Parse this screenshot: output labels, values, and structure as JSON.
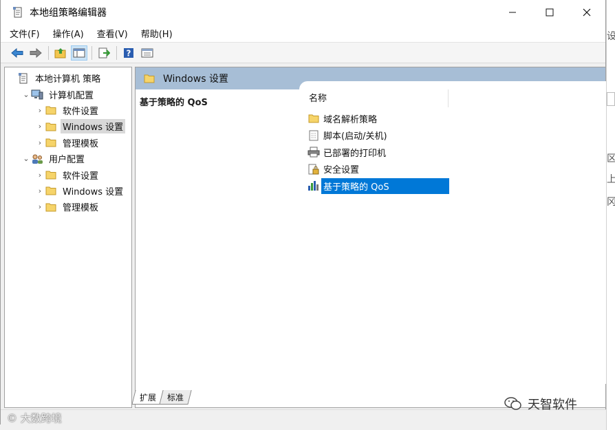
{
  "window": {
    "title": "本地组策略编辑器",
    "controls": {
      "minimize": "—",
      "maximize": "☐",
      "close": "✕"
    }
  },
  "menu": [
    "文件(F)",
    "操作(A)",
    "查看(V)",
    "帮助(H)"
  ],
  "toolbar": {
    "icons": [
      "back-arrow-icon",
      "forward-arrow-icon",
      "up-folder-icon",
      "show-hide-tree-icon",
      "export-list-icon",
      "help-icon",
      "properties-icon"
    ]
  },
  "tree": {
    "items": [
      {
        "label": "本地计算机 策略",
        "level": 0,
        "icon": "policy-icon",
        "chevron": ""
      },
      {
        "label": "计算机配置",
        "level": 1,
        "icon": "computer-icon",
        "chevron": "⌄"
      },
      {
        "label": "软件设置",
        "level": 2,
        "icon": "folder-icon",
        "chevron": "›"
      },
      {
        "label": "Windows 设置",
        "level": 2,
        "icon": "folder-icon",
        "chevron": "›",
        "selected": true
      },
      {
        "label": "管理模板",
        "level": 2,
        "icon": "folder-icon",
        "chevron": "›"
      },
      {
        "label": "用户配置",
        "level": 1,
        "icon": "users-icon",
        "chevron": "⌄"
      },
      {
        "label": "软件设置",
        "level": 2,
        "icon": "folder-icon",
        "chevron": "›"
      },
      {
        "label": "Windows 设置",
        "level": 2,
        "icon": "folder-icon",
        "chevron": "›"
      },
      {
        "label": "管理模板",
        "level": 2,
        "icon": "folder-icon",
        "chevron": "›"
      }
    ]
  },
  "right": {
    "header": "Windows 设置",
    "description_title": "基于策略的 QoS",
    "column_header": "名称",
    "items": [
      {
        "label": "域名解析策略",
        "icon": "folder-icon"
      },
      {
        "label": "脚本(启动/关机)",
        "icon": "script-icon"
      },
      {
        "label": "已部署的打印机",
        "icon": "printer-icon"
      },
      {
        "label": "安全设置",
        "icon": "security-icon"
      },
      {
        "label": "基于策略的 QoS",
        "icon": "qos-chart-icon",
        "selected": true
      }
    ]
  },
  "tabs": [
    "扩展",
    "标准"
  ],
  "watermarks": {
    "left": "大数跨境",
    "right": "天智软件"
  },
  "edge_chars": [
    "设",
    "区",
    "上",
    "冈"
  ],
  "colors": {
    "header_bg": "#a7bed6",
    "selection": "#0078d7",
    "tree_selection": "#d9d9d9"
  }
}
